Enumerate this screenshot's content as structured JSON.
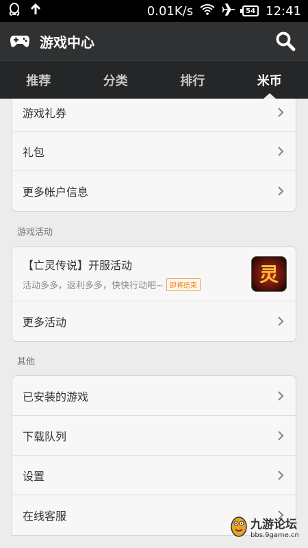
{
  "status_bar": {
    "network_speed": "0.01K/s",
    "battery": "54",
    "time": "12:41"
  },
  "header": {
    "title": "游戏中心"
  },
  "tabs": [
    {
      "label": "推荐",
      "active": false
    },
    {
      "label": "分类",
      "active": false
    },
    {
      "label": "排行",
      "active": false
    },
    {
      "label": "米币",
      "active": true
    }
  ],
  "account_section": {
    "items": [
      {
        "label": "游戏礼券"
      },
      {
        "label": "礼包"
      },
      {
        "label": "更多帐户信息"
      }
    ]
  },
  "activity_section": {
    "title": "游戏活动",
    "activity": {
      "title": "【亡灵传说】开服活动",
      "subtitle": "活动多多，返利多多，快快行动吧~",
      "badge": "即将结束",
      "icon_glyph": "灵"
    },
    "more_label": "更多活动"
  },
  "other_section": {
    "title": "其他",
    "items": [
      {
        "label": "已安装的游戏"
      },
      {
        "label": "下载队列"
      },
      {
        "label": "设置"
      },
      {
        "label": "在线客服"
      }
    ]
  },
  "watermark": {
    "name": "九游论坛",
    "url": "bbs.9game.cn"
  },
  "colors": {
    "header_bg": "#2f3133",
    "tabs_bg": "#242628",
    "page_bg": "#ececec",
    "badge": "#e8861a"
  }
}
